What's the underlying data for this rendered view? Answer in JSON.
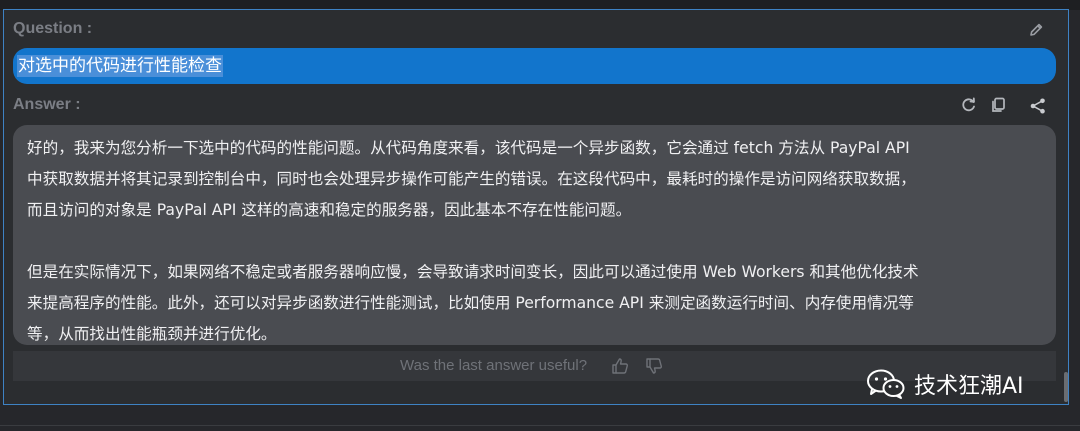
{
  "question": {
    "label": "Question :",
    "text": "对选中的代码进行性能检查"
  },
  "answer": {
    "label": "Answer :",
    "paragraphs": [
      [
        "好的，我来为您分析一下选中的代码的性能问题。从代码角度来看，该代码是一个异步函数，它会通过 fetch 方法从 PayPal API",
        "中获取数据并将其记录到控制台中，同时也会处理异步操作可能产生的错误。在这段代码中，最耗时的操作是访问网络获取数据，",
        "而且访问的对象是 PayPal API 这样的高速和稳定的服务器，因此基本不存在性能问题。"
      ],
      [
        "但是在实际情况下，如果网络不稳定或者服务器响应慢，会导致请求时间变长，因此可以通过使用 Web Workers 和其他优化技术",
        "来提高程序的性能。此外，还可以对异步函数进行性能测试，比如使用 Performance API 来测定函数运行时间、内存使用情况等",
        "等，从而找出性能瓶颈并进行优化。"
      ]
    ]
  },
  "feedback": {
    "prompt": "Was the last answer useful?"
  },
  "watermark": {
    "text": "技术狂潮AI"
  },
  "icons": {
    "edit": "pencil-icon",
    "refresh": "refresh-icon",
    "copy": "copy-icon",
    "share": "share-icon",
    "thumbs_up": "thumbs-up-icon",
    "thumbs_down": "thumbs-down-icon",
    "watermark": "wechat-icon"
  },
  "colors": {
    "panel_bg": "#2b2d30",
    "question_bg": "#1275cc",
    "answer_bg": "#4a4c51",
    "panel_border": "#3e82c4"
  }
}
